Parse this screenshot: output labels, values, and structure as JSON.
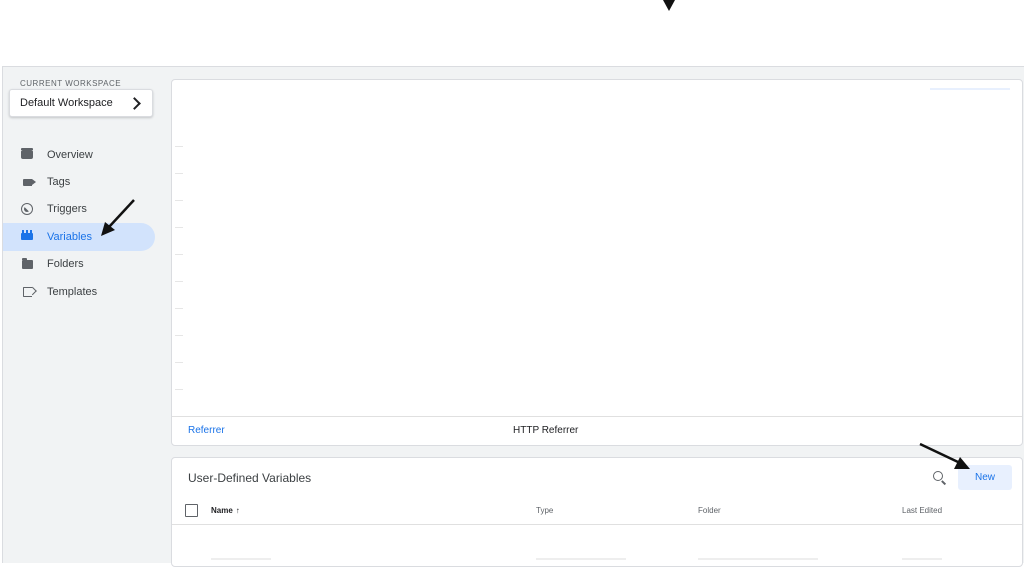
{
  "workspace": {
    "label": "CURRENT WORKSPACE",
    "name": "Default Workspace"
  },
  "nav": {
    "overview": "Overview",
    "tags": "Tags",
    "triggers": "Triggers",
    "variables": "Variables",
    "folders": "Folders",
    "templates": "Templates",
    "active": "variables"
  },
  "builtin_row": {
    "name": "Referrer",
    "type": "HTTP Referrer"
  },
  "user_defined": {
    "title": "User-Defined Variables",
    "new_label": "New",
    "columns": {
      "name": "Name",
      "sort_arrow": "↑",
      "type": "Type",
      "folder": "Folder",
      "last_edited": "Last Edited"
    }
  },
  "colors": {
    "accent": "#1a73e8",
    "active_bg": "#d2e3fc",
    "button_bg": "#e8f0fe",
    "sidebar_bg": "#f1f3f4"
  }
}
